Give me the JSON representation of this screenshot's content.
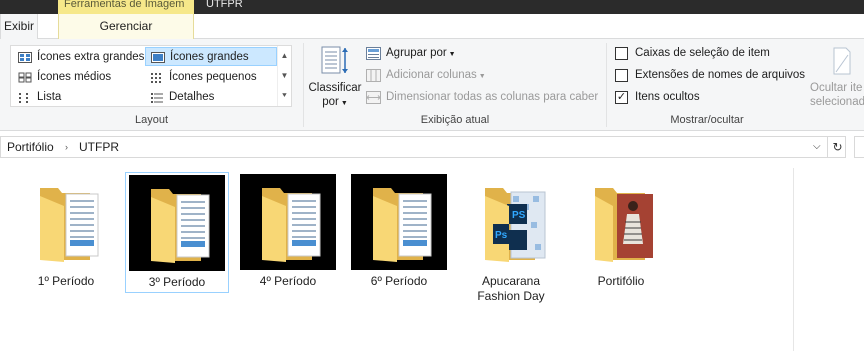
{
  "window": {
    "contextual_tab": "Ferramentas de Imagem",
    "app_name": "UTFPR"
  },
  "tabs": {
    "exibir": "Exibir",
    "gerenciar": "Gerenciar"
  },
  "ribbon": {
    "layout": {
      "label": "Layout",
      "items": [
        {
          "label": "Ícones extra grandes",
          "icon": "extra-large-icons-icon"
        },
        {
          "label": "Ícones grandes",
          "icon": "large-icons-icon",
          "selected": true
        },
        {
          "label": "Ícones médios",
          "icon": "medium-icons-icon"
        },
        {
          "label": "Ícones pequenos",
          "icon": "small-icons-icon"
        },
        {
          "label": "Lista",
          "icon": "list-icon"
        },
        {
          "label": "Detalhes",
          "icon": "details-icon"
        }
      ]
    },
    "current_view": {
      "label": "Exibição atual",
      "sort_line1": "Classificar",
      "sort_line2": "por",
      "group_by": "Agrupar por",
      "add_columns": "Adicionar colunas",
      "size_columns": "Dimensionar todas as colunas para caber"
    },
    "show_hide": {
      "label": "Mostrar/ocultar",
      "checkboxes": [
        {
          "label": "Caixas de seleção de item",
          "checked": false
        },
        {
          "label": "Extensões de nomes de arquivos",
          "checked": false
        },
        {
          "label": "Itens ocultos",
          "checked": true
        }
      ],
      "hide_selected_line1": "Ocultar ite",
      "hide_selected_line2": "selecionad"
    }
  },
  "address": {
    "crumbs": [
      "Portifólio",
      "UTFPR"
    ]
  },
  "files": [
    {
      "name": "1º Período",
      "type": "folder-docs"
    },
    {
      "name": "3º Período",
      "type": "folder-docs-dark",
      "selected": true
    },
    {
      "name": "4º Período",
      "type": "folder-docs-dark"
    },
    {
      "name": "6º Período",
      "type": "folder-docs-dark"
    },
    {
      "name": "Apucarana Fashion Day",
      "type": "folder-photoshop"
    },
    {
      "name": "Portifólio",
      "type": "folder-photo"
    }
  ],
  "colors": {
    "accent_selected": "#cce8ff",
    "folder_yellow": "#f8d775",
    "folder_shadow": "#e0b24a",
    "ribbon_bg": "#f5f6f7"
  }
}
